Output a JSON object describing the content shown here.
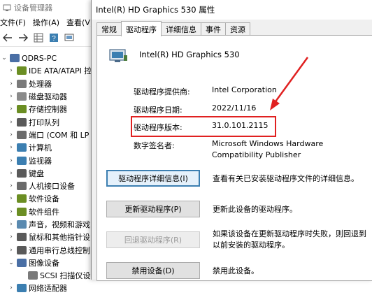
{
  "device_manager": {
    "title": "设备管理器",
    "menu": [
      "文件(F)",
      "操作(A)",
      "查看(V)"
    ],
    "tree": [
      {
        "label": "QDRS-PC",
        "level": 0,
        "expander": "⌄",
        "color": "#4a6fa5"
      },
      {
        "label": "IDE ATA/ATAPI 控",
        "level": 1,
        "expander": "›",
        "color": "#6b8e23"
      },
      {
        "label": "处理器",
        "level": 1,
        "expander": "›",
        "color": "#7a7a7a"
      },
      {
        "label": "磁盘驱动器",
        "level": 1,
        "expander": "›",
        "color": "#8a8a8a"
      },
      {
        "label": "存储控制器",
        "level": 1,
        "expander": "›",
        "color": "#6b8e23"
      },
      {
        "label": "打印队列",
        "level": 1,
        "expander": "›",
        "color": "#5a5a5a"
      },
      {
        "label": "端口 (COM 和 LP",
        "level": 1,
        "expander": "›",
        "color": "#6b6b6b"
      },
      {
        "label": "计算机",
        "level": 1,
        "expander": "›",
        "color": "#3c7fb1"
      },
      {
        "label": "监视器",
        "level": 1,
        "expander": "›",
        "color": "#3c7fb1"
      },
      {
        "label": "键盘",
        "level": 1,
        "expander": "›",
        "color": "#5a5a5a"
      },
      {
        "label": "人机接口设备",
        "level": 1,
        "expander": "›",
        "color": "#6b6b6b"
      },
      {
        "label": "软件设备",
        "level": 1,
        "expander": "›",
        "color": "#6b8e23"
      },
      {
        "label": "软件组件",
        "level": 1,
        "expander": "›",
        "color": "#6b8e23"
      },
      {
        "label": "声音，视频和游戏",
        "level": 1,
        "expander": "›",
        "color": "#5a8ab0"
      },
      {
        "label": "鼠标和其他指针设",
        "level": 1,
        "expander": "›",
        "color": "#5a5a5a"
      },
      {
        "label": "通用串行总线控制",
        "level": 1,
        "expander": "›",
        "color": "#5a5a5a"
      },
      {
        "label": "图像设备",
        "level": 1,
        "expander": "⌄",
        "color": "#4a6fa5"
      },
      {
        "label": "SCSI 扫描仪设",
        "level": 2,
        "expander": "",
        "color": "#7a7a7a"
      },
      {
        "label": "网络适配器",
        "level": 1,
        "expander": "›",
        "color": "#3c7fb1"
      }
    ]
  },
  "dialog": {
    "title": "Intel(R) HD Graphics 530 属性",
    "tabs": [
      "常规",
      "驱动程序",
      "详细信息",
      "事件",
      "资源"
    ],
    "active_tab": 1,
    "device_name": "Intel(R) HD Graphics 530",
    "fields": {
      "provider_label": "驱动程序提供商:",
      "provider_value": "Intel Corporation",
      "date_label": "驱动程序日期:",
      "date_value": "2022/11/16",
      "version_label": "驱动程序版本:",
      "version_value": "31.0.101.2115",
      "signer_label": "数字签名者:",
      "signer_value_line1": "Microsoft Windows Hardware",
      "signer_value_line2": "Compatibility Publisher"
    },
    "buttons": {
      "details_label": "驱动程序详细信息(I)",
      "details_desc": "查看有关已安装驱动程序文件的详细信息。",
      "update_label": "更新驱动程序(P)",
      "update_desc": "更新此设备的驱动程序。",
      "rollback_label": "回退驱动程序(R)",
      "rollback_desc_line1": "如果该设备在更新驱动程序时失败，则回退到",
      "rollback_desc_line2": "以前安装的驱动程序。",
      "disable_label": "禁用设备(D)",
      "disable_desc": "禁用此设备。"
    }
  },
  "annotation": {
    "color": "#e02020"
  }
}
